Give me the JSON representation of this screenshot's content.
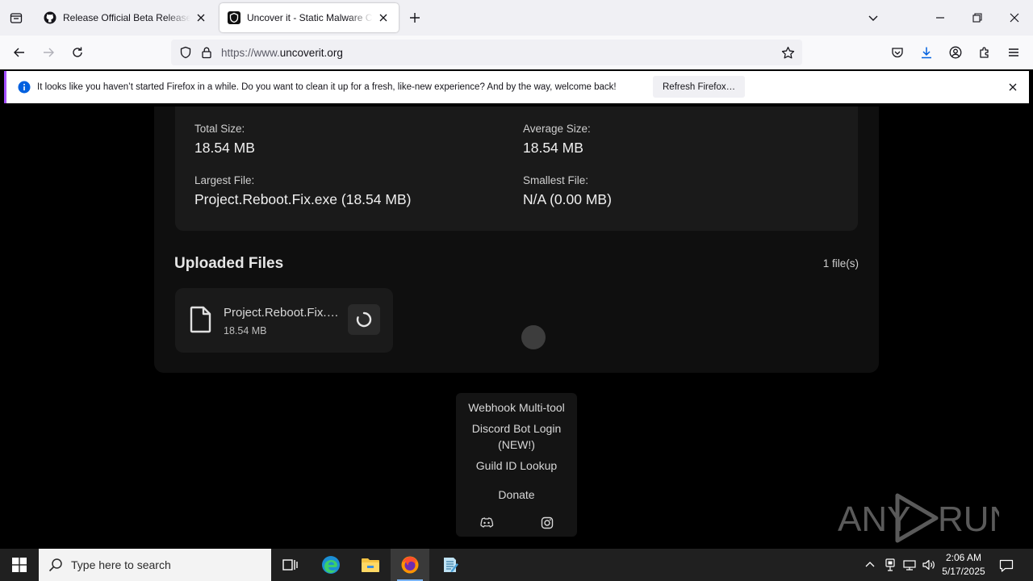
{
  "browser": {
    "tabs": [
      {
        "title": "Release Official Beta Release! · B",
        "active": false
      },
      {
        "title": "Uncover it - Static Malware Con",
        "active": true
      }
    ],
    "url": {
      "prefix": "https://www.",
      "domain": "uncoverit.org"
    }
  },
  "notification": {
    "message": "It looks like you haven’t started Firefox in a while. Do you want to clean it up for a fresh, like-new experience? And by the way, welcome back!",
    "button_label": "Refresh Firefox…"
  },
  "stats": {
    "total_size_label": "Total Size:",
    "total_size_value": "18.54 MB",
    "average_size_label": "Average Size:",
    "average_size_value": "18.54 MB",
    "largest_file_label": "Largest File:",
    "largest_file_value": "Project.Reboot.Fix.exe (18.54 MB)",
    "smallest_file_label": "Smallest File:",
    "smallest_file_value": "N/A (0.00 MB)"
  },
  "uploaded": {
    "title": "Uploaded Files",
    "count": "1 file(s)",
    "files": [
      {
        "name": "Project.Reboot.Fix.exe",
        "size": "18.54 MB"
      }
    ]
  },
  "menu": {
    "items": [
      "Webhook Multi-tool",
      "Discord Bot Login",
      "(NEW!)",
      "Guild ID Lookup",
      "Donate"
    ],
    "social": [
      "discord-icon",
      "instagram-icon"
    ]
  },
  "watermark": {
    "text_left": "ANY",
    "text_right": "RUN"
  },
  "taskbar": {
    "search_placeholder": "Type here to search",
    "time": "2:06 AM",
    "date": "5/17/2025"
  },
  "colors": {
    "accent_notification": "#a34eff",
    "page_bg": "#000000",
    "card_bg": "#1a1a1a",
    "taskbar_bg": "#202020"
  }
}
